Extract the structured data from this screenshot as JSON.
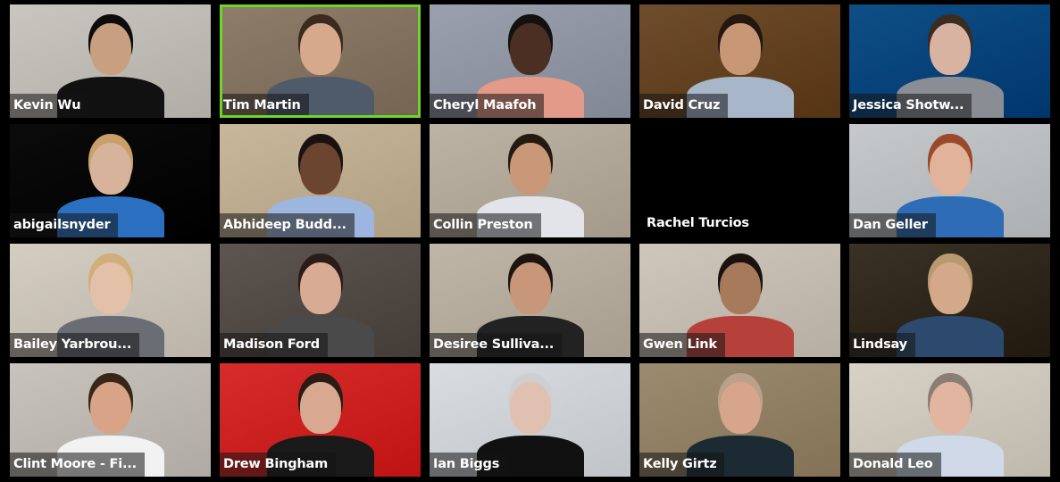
{
  "meeting": {
    "view": "gallery",
    "active_speaker": "Tim Martin",
    "accent_color": "#6cd72a"
  },
  "participants": [
    {
      "name": "Kevin Wu",
      "video": true,
      "bg": "#c9c6c0",
      "skin": "#c9a07f",
      "shirt": "#111111",
      "hair": "#0c0c0c"
    },
    {
      "name": "Tim Martin",
      "video": true,
      "bg": "#8e7d6a",
      "skin": "#d6a98c",
      "shirt": "#4f5a6b",
      "hair": "#3a2a20",
      "active": true
    },
    {
      "name": "Cheryl Maafoh",
      "video": true,
      "bg": "#9aa0ad",
      "skin": "#4a2f22",
      "shirt": "#e49a88",
      "hair": "#141010"
    },
    {
      "name": "David Cruz",
      "video": true,
      "bg": "#6e4d2c",
      "skin": "#c79776",
      "shirt": "#a8b6c9",
      "hair": "#241710"
    },
    {
      "name": "Jessica Shotw...",
      "video": true,
      "bg": "#0e4f86",
      "skin": "#d9b3a1",
      "shirt": "#8a8e94",
      "hair": "#3b2c22"
    },
    {
      "name": "abigailsnyder",
      "video": true,
      "bg": "#0b0b0b",
      "skin": "#d8b39b",
      "shirt": "#2a6fc0",
      "hair": "#c9a06a"
    },
    {
      "name": "Abhideep Budd...",
      "video": true,
      "bg": "#c9b79b",
      "skin": "#6b4530",
      "shirt": "#9db6df",
      "hair": "#1a1210"
    },
    {
      "name": "Collin Preston",
      "video": true,
      "bg": "#bdb3a4",
      "skin": "#c99878",
      "shirt": "#e3e4ea",
      "hair": "#241a12"
    },
    {
      "name": "Rachel Turcios",
      "video": false
    },
    {
      "name": "Dan Geller",
      "video": true,
      "bg": "#c5c9cc",
      "skin": "#e0b39a",
      "shirt": "#2e6db5",
      "hair": "#9a4a2a"
    },
    {
      "name": "Bailey Yarbrou...",
      "video": true,
      "bg": "#d4cdc2",
      "skin": "#e3c0a8",
      "shirt": "#6a6d73",
      "hair": "#cfae7c"
    },
    {
      "name": "Madison Ford",
      "video": true,
      "bg": "#5d5550",
      "skin": "#d8ab94",
      "shirt": "#4a4a4a",
      "hair": "#2a1c16"
    },
    {
      "name": "Desiree Sulliva...",
      "video": true,
      "bg": "#bfb6a8",
      "skin": "#c89679",
      "shirt": "#222222",
      "hair": "#1e140f"
    },
    {
      "name": "Gwen Link",
      "video": true,
      "bg": "#cfc7bb",
      "skin": "#a87a5c",
      "shirt": "#b6413b",
      "hair": "#1a1210"
    },
    {
      "name": "Lindsay",
      "video": true,
      "bg": "#3a3226",
      "skin": "#d4a98a",
      "shirt": "#2c4a6e",
      "hair": "#b99a70"
    },
    {
      "name": "Clint Moore - Fi...",
      "video": true,
      "bg": "#c8c3bc",
      "skin": "#d9a388",
      "shirt": "#f2f2f2",
      "hair": "#3a2618"
    },
    {
      "name": "Drew Bingham",
      "video": true,
      "bg": "#d72c2c",
      "skin": "#d9a890",
      "shirt": "#1a1a1a",
      "hair": "#2a1c14"
    },
    {
      "name": "Ian Biggs",
      "video": true,
      "bg": "#d9dde2",
      "skin": "#e0c0b0",
      "shirt": "#111111",
      "hair": "#cfcfcf"
    },
    {
      "name": "Kelly Girtz",
      "video": true,
      "bg": "#9c8b6e",
      "skin": "#d6a58c",
      "shirt": "#1b2a33",
      "hair": "#bba08a"
    },
    {
      "name": "Donald Leo",
      "video": true,
      "bg": "#d8d2c6",
      "skin": "#e1b5a0",
      "shirt": "#cfd9e8",
      "hair": "#8a7e72"
    }
  ]
}
